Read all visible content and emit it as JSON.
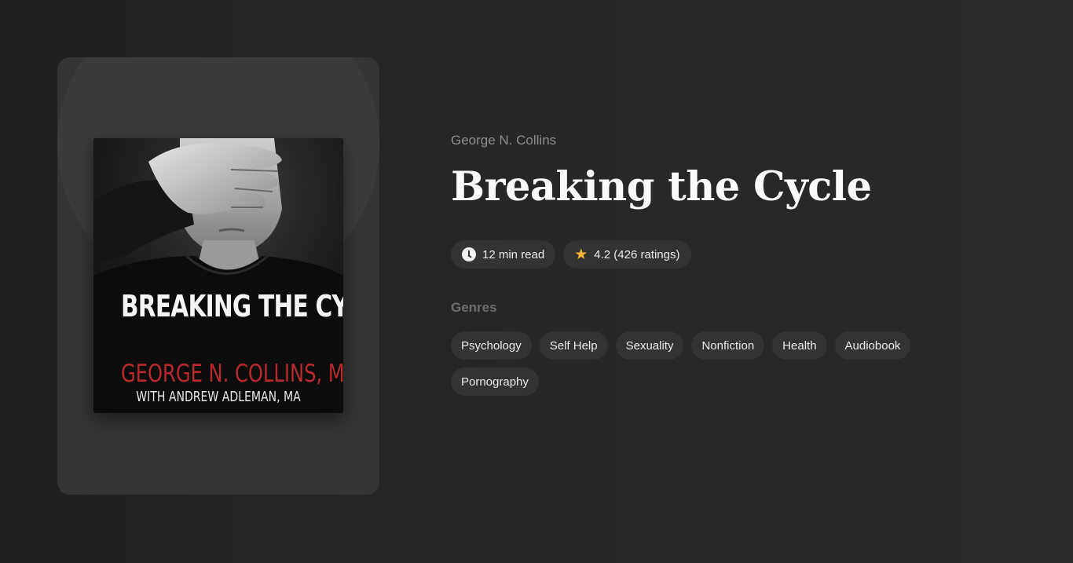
{
  "book": {
    "author": "George N. Collins",
    "title": "Breaking the Cycle",
    "read_time": "12 min read",
    "rating": "4.2 (426 ratings)",
    "cover": {
      "title": "BREAKING THE CYCLE",
      "author": "GEORGE N. COLLINS, MA",
      "coauthor": "WITH ANDREW ADLEMAN, MA"
    }
  },
  "genres": {
    "label": "Genres",
    "items": [
      "Psychology",
      "Self Help",
      "Sexuality",
      "Nonfiction",
      "Health",
      "Audiobook",
      "Pornography"
    ]
  },
  "icons": {
    "read_time": "clock-icon",
    "rating": "star-icon"
  },
  "colors": {
    "star": "#f5b731",
    "cover_author": "#b8282e",
    "pill_bg": "#333333"
  }
}
